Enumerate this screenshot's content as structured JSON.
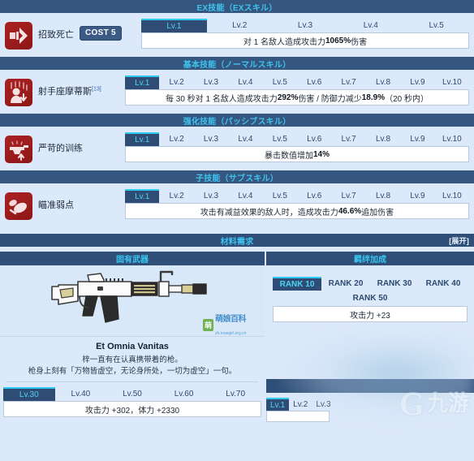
{
  "skills": [
    {
      "section_title": "EX技能（EXスキル）",
      "icon": "ex-skill-icon",
      "name": "招致死亡",
      "cost_label": "COST 5",
      "superscript": "",
      "levels": [
        "Lv.1",
        "Lv.2",
        "Lv.3",
        "Lv.4",
        "Lv.5"
      ],
      "active_level": "Lv.1",
      "description_prefix": "对 1 名敌人造成攻击力 ",
      "description_value": "1065%",
      "description_suffix": " 伤害"
    },
    {
      "section_title": "基本技能（ノーマルスキル）",
      "icon": "normal-skill-icon",
      "name": "射手座摩蒂斯",
      "superscript": "[13]",
      "cost_label": "",
      "levels": [
        "Lv.1",
        "Lv.2",
        "Lv.3",
        "Lv.4",
        "Lv.5",
        "Lv.6",
        "Lv.7",
        "Lv.8",
        "Lv.9",
        "Lv.10"
      ],
      "active_level": "Lv.1",
      "description_prefix": "每 30 秒对 1 名敌人造成攻击力 ",
      "description_value": "292%",
      "description_mid": " 伤害 / 防御力减少 ",
      "description_value2": "18.9%",
      "description_suffix": "（20 秒内）"
    },
    {
      "section_title": "强化技能（パッシブスキル）",
      "icon": "passive-skill-icon",
      "name": "严苛的训练",
      "superscript": "",
      "cost_label": "",
      "levels": [
        "Lv.1",
        "Lv.2",
        "Lv.3",
        "Lv.4",
        "Lv.5",
        "Lv.6",
        "Lv.7",
        "Lv.8",
        "Lv.9",
        "Lv.10"
      ],
      "active_level": "Lv.1",
      "description_prefix": "暴击数值增加 ",
      "description_value": "14%",
      "description_suffix": ""
    },
    {
      "section_title": "子技能（サブスキル）",
      "icon": "sub-skill-icon",
      "name": "瞄准弱点",
      "superscript": "",
      "cost_label": "",
      "levels": [
        "Lv.1",
        "Lv.2",
        "Lv.3",
        "Lv.4",
        "Lv.5",
        "Lv.6",
        "Lv.7",
        "Lv.8",
        "Lv.9",
        "Lv.10"
      ],
      "active_level": "Lv.1",
      "description_prefix": "攻击有减益效果的敌人时，造成攻击力 ",
      "description_value": "46.6%",
      "description_suffix": " 追加伤害"
    }
  ],
  "material": {
    "title": "材料需求",
    "expand_label": "[展开]"
  },
  "weapon": {
    "column_title": "固有武器",
    "name": "Et Omnia Vanitas",
    "desc_line1": "梓一直有在认真携带着的枪。",
    "desc_line2": "枪身上刻有「万物皆虚空，无论身所处，一切为虚空」一句。",
    "levels": [
      "Lv.30",
      "Lv.40",
      "Lv.50",
      "Lv.60",
      "Lv.70"
    ],
    "active_level": "Lv.30",
    "stat_text": "攻击力 +302，体力 +2330",
    "watermark_badge": "萌",
    "watermark_title": "萌娘百科",
    "watermark_url": "zh.moegirl.org.cn"
  },
  "bond": {
    "column_title": "羁绊加成",
    "ranks_row1": [
      "RANK 10",
      "RANK 20",
      "RANK 30",
      "RANK 40"
    ],
    "ranks_row2": [
      "RANK 50"
    ],
    "active_rank": "RANK 10",
    "bonus_text": "攻击力 +23"
  },
  "bottom_stub": {
    "levels": [
      "Lv.1",
      "Lv.2",
      "Lv.3"
    ],
    "active_level": "Lv.1"
  },
  "nine_watermark": {
    "mark": "G",
    "text": "九游"
  }
}
